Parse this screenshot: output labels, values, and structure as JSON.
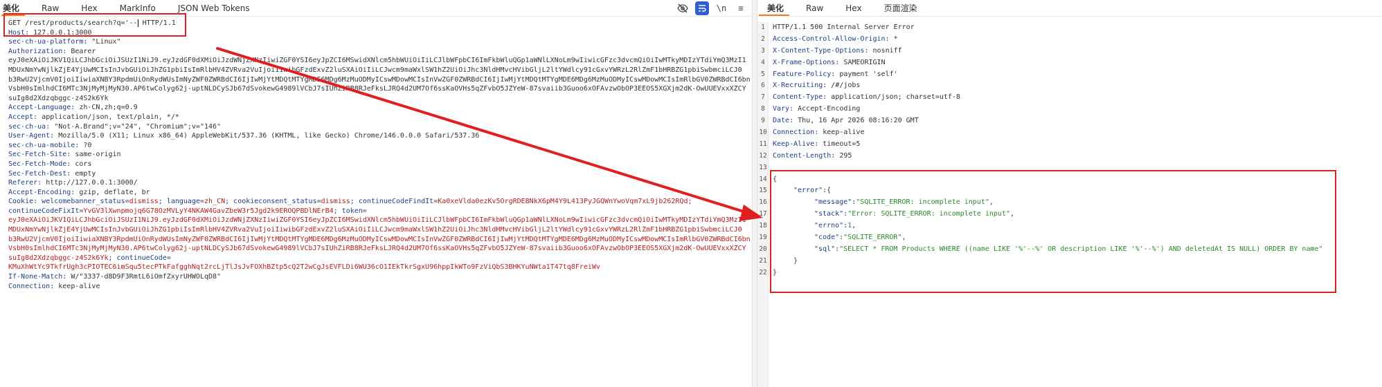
{
  "left": {
    "tabs": [
      "美化",
      "Raw",
      "Hex",
      "MarkInfo",
      "JSON Web Tokens"
    ],
    "toolbar": {
      "wrap_label": "\\n",
      "menu_label": "≡"
    },
    "request_line_a": "GET /rest/products/search?q='--",
    "request_line_b": " HTTP/1.1",
    "headers": [
      {
        "k": "Host:",
        "v": " 127.0.0.1:3000"
      },
      {
        "k": "sec-ch-ua-platform:",
        "v": " \"Linux\""
      },
      {
        "k": "Authorization:",
        "v": " Bearer"
      },
      {
        "k": "",
        "v": "eyJ0eXAiOiJKV1QiLCJhbGciOiJSUzI1NiJ9.eyJzdGF0dXMiOiJzdWNjZXNzIiwiZGF0YSI6eyJpZCI6MSwidXNlcm5hbWUiOiIiLCJlbWFpbCI6ImFkbWluQGp1aWNlLXNoLm9wIiwicGFzc3dvcmQiOiIwMTkyMDIzYTdiYmQ3MzI1"
      },
      {
        "k": "",
        "v": "MDUxNmYwNjlkZjE4YjUwMCIsInJvbGUiOiJhZG1pbiIsImRlbHV4ZVRva2VuIjoiIiwibGFzdExvZ2luSXAiOiIiLCJwcm9maWxlSW1hZ2UiOiJhc3NldHMvcHVibGljL2ltYWdlcy91cGxvYWRzL2RlZmF1bHRBZG1pbiSwbmciLCJ0"
      },
      {
        "k": "",
        "v": "b3RwU2VjcmV0IjoiIiwiaXNBY3RpdmUiOnRydWUsImNyZWF0ZWRBdCI6IjIwMjYtMDQtMTYgMDE6MDg6MzMuODMyICswMDowMCIsInVwZGF0ZWRBdCI6IjIwMjYtMDQtMTYgMDE6MDg6MzMuODMyICswMDowMCIsImRlbGV0ZWRBdCI6bn"
      },
      {
        "k": "",
        "v": "VsbH0sImlhdCI6MTc3NjMyMjMyN30.AP6twColyg62j-uptNLDCySJb67dSvokewG4989lVCbJ7sIUhZiRB8RJeFksLJRQ4d2UM7Of6ssKaOVHs5qZFvbO5JZYeW-87svaiib3Guoo6xOFAvzwObOP3EEOS5XGXjm2dK-OwUUEVxxXZCY"
      },
      {
        "k": "",
        "v": "suIg8d2Xdzqbggc-z4S2k6Yk"
      },
      {
        "k": "Accept-Language:",
        "v": " zh-CN,zh;q=0.9"
      },
      {
        "k": "Accept:",
        "v": " application/json, text/plain, */*"
      },
      {
        "k": "sec-ch-ua:",
        "v": " \"Not-A.Brand\";v=\"24\", \"Chromium\";v=\"146\""
      },
      {
        "k": "User-Agent:",
        "v": " Mozilla/5.0 (X11; Linux x86_64) AppleWebKit/537.36 (KHTML, like Gecko) Chrome/146.0.0.0 Safari/537.36"
      },
      {
        "k": "sec-ch-ua-mobile:",
        "v": " ?0"
      },
      {
        "k": "Sec-Fetch-Site:",
        "v": " same-origin"
      },
      {
        "k": "Sec-Fetch-Mode:",
        "v": " cors"
      },
      {
        "k": "Sec-Fetch-Dest:",
        "v": " empty"
      },
      {
        "k": "Referer:",
        "v": " http://127.0.0.1:3000/"
      },
      {
        "k": "Accept-Encoding:",
        "v": " gzip, deflate, br"
      }
    ],
    "cookie_label": "Cookie:",
    "cookie_parts": [
      {
        "k": " welcomebanner_status",
        "v": "dismiss"
      },
      {
        "k": "; language",
        "v": "zh_CN"
      },
      {
        "k": "; cookieconsent_status",
        "v": "dismiss"
      },
      {
        "k": "; continueCodeFindIt",
        "v": "Ka0xeVlda0ezKv5OrgRDEBNkX6pM4Y9L413PyJGQWnYwoVqm7xL9jb262RQd;"
      }
    ],
    "cookie_line2_k": "continueCodeFixIt",
    "cookie_line2_v": "YvGV3lXwnpmojq6G78OzMVLyY4NKAW4GavZbeW3r5Jgd2k9EROQPBDlNErB4",
    "cookie_token_k": "; token",
    "cookie_token_lines": [
      "eyJ0eXAiOiJKV1QiLCJhbGciOiJSUzI1NiJ9.eyJzdGF0dXMiOiJzdWNjZXNzIiwiZGF0YSI6eyJpZCI6MSwidXNlcm5hbWUiOiIiLCJlbWFpbCI6ImFkbWluQGp1aWNlLXNoLm9wIiwicGFzc3dvcmQiOiIwMTkyMDIzYTdiYmQ3MzI1",
      "MDUxNmYwNjlkZjE4YjUwMCIsInJvbGUiOiJhZG1pbiIsImRlbHV4ZVRva2VuIjoiIiwibGFzdExvZ2luSXAiOiIiLCJwcm9maWxlSW1hZ2UiOiJhc3NldHMvcHVibGljL2ltYWdlcy91cGxvYWRzL2RlZmF1bHRBZG1pbiSwbmciLCJ0",
      "b3RwU2VjcmV0IjoiIiwiaXNBY3RpdmUiOnRydWUsImNyZWF0ZWRBdCI6IjIwMjYtMDQtMTYgMDE6MDg6MzMuODMyICswMDowMCIsInVwZGF0ZWRBdCI6IjIwMjYtMDQtMTYgMDE6MDg6MzMuODMyICswMDowMCIsImRlbGV0ZWRBdCI6bn",
      "VsbH0sImlhdCI6MTc3NjMyMjMyN30.AP6twColyg62j-uptNLDCySJb67dSvokewG4989lVCbJ7sIUhZiRB8RJeFksLJRQ4d2UM7Of6ssKaOVHs5qZFvbO5JZYeW-87svaiib3Guoo6xOFAvzwObOP3EEOS5XGXjm2dK-OwUUEVxxXZCY"
    ],
    "cookie_last_v": "suIg8d2Xdzqbggc-z4S2k6Yk",
    "cookie_continue_k": "; continueCode",
    "cookie_continue_v": "KMuXhWtYc9TkfrUgh3cPIOTEC6imSqu5tecPTkFafgghNqt2rcLjTlJsJvFOXhBZtp5cQ2T2wCgJsEVFLDi6WU36cO1IEkTkrSgxU96hppIkWTo9FzViQbS3BHKYuNWta1T47tq8FreiWv",
    "if_none_match": {
      "k": "If-None-Match:",
      "v": " W/\"3337-d8D9F3RmtL6iOmfZxyrUHWOLqD8\""
    },
    "connection": {
      "k": "Connection:",
      "v": " keep-alive"
    }
  },
  "right": {
    "tabs": [
      "美化",
      "Raw",
      "Hex",
      "页面渲染"
    ],
    "status_line": "HTTP/1.1 500 Internal Server Error",
    "headers": [
      {
        "k": "Access-Control-Allow-Origin:",
        "v": " *"
      },
      {
        "k": "X-Content-Type-Options:",
        "v": " nosniff"
      },
      {
        "k": "X-Frame-Options:",
        "v": " SAMEORIGIN"
      },
      {
        "k": "Feature-Policy:",
        "v": " payment 'self'"
      },
      {
        "k": "X-Recruiting:",
        "v": " /#/jobs"
      },
      {
        "k": "Content-Type:",
        "v": " application/json; charset=utf-8"
      },
      {
        "k": "Vary:",
        "v": " Accept-Encoding"
      },
      {
        "k": "Date:",
        "v": " Thu, 16 Apr 2026 08:16:20 GMT"
      },
      {
        "k": "Connection:",
        "v": " keep-alive"
      },
      {
        "k": "Keep-Alive:",
        "v": " timeout=5"
      },
      {
        "k": "Content-Length:",
        "v": " 295"
      }
    ],
    "line_numbers": [
      "1",
      "2",
      "3",
      "4",
      "5",
      "6",
      "7",
      "8",
      "9",
      "10",
      "11",
      "12",
      "13",
      "14",
      "15",
      "16",
      "17",
      "18",
      "19",
      "20",
      "21",
      "22"
    ],
    "json": {
      "open": "{",
      "error_key": "\"error\"",
      "error_open": ":{",
      "fields": [
        {
          "k": "\"message\"",
          "v": "\"SQLITE_ERROR: incomplete input\"",
          "sep": ","
        },
        {
          "k": "\"stack\"",
          "v": "\"Error: SQLITE_ERROR: incomplete input\"",
          "sep": ","
        },
        {
          "k": "\"errno\"",
          "v": "1",
          "sep": ","
        },
        {
          "k": "\"code\"",
          "v": "\"SQLITE_ERROR\"",
          "sep": ","
        },
        {
          "k": "\"sql\"",
          "v": "\"SELECT * FROM Products WHERE ((name LIKE '%'--%' OR description LIKE '%'--%') AND deletedAt IS NULL) ORDER BY name\"",
          "sep": ""
        }
      ],
      "error_close": "}",
      "close": "}"
    }
  },
  "colors": {
    "annotation": "#e02020",
    "active_tab": "#f07b1a",
    "toolbar_active": "#2f5fd0"
  }
}
